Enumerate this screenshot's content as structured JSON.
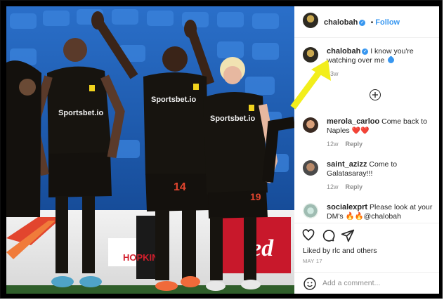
{
  "post": {
    "username": "chalobah",
    "follow_label": "Follow",
    "caption_username": "chalobah",
    "caption_text": "I know you're watching over me",
    "caption_time": "13w",
    "photo_sponsor": "Sportsbet.io",
    "photo_board": "HOPKIN",
    "photo_board_right": "ed",
    "player_numbers": [
      "14",
      "19"
    ]
  },
  "comments": [
    {
      "username": "merola_carloo",
      "text": "Come back to Naples",
      "emoji": "❤️❤️",
      "time": "12w",
      "reply": "Reply"
    },
    {
      "username": "saint_azizz",
      "text": "Come to Galatasaray!!!",
      "time": "12w",
      "reply": "Reply"
    },
    {
      "username": "socialexprt",
      "text": "Please look at your DM's 🔥🔥@chalobah"
    }
  ],
  "actions": {
    "likes_text": "Liked by rlc and others",
    "date": "MAY 17",
    "add_comment_placeholder": "Add a comment..."
  },
  "colors": {
    "link_blue": "#3897f0",
    "arrow_yellow": "#f2ee1c",
    "jersey_black": "#17140f",
    "seat_blue": "#1f5fb4"
  },
  "icons": [
    "verified-badge-icon",
    "add-circle-icon",
    "heart-icon",
    "comment-icon",
    "share-icon",
    "emoji-icon",
    "arrow-icon"
  ]
}
